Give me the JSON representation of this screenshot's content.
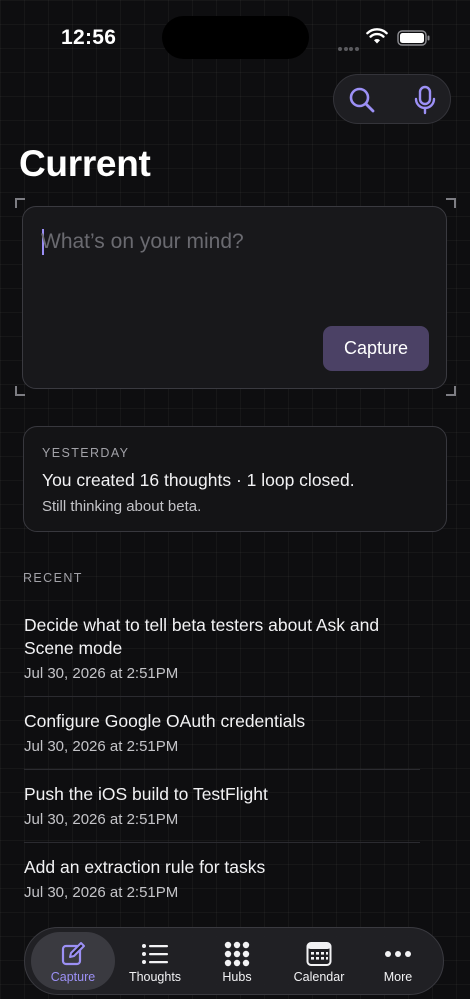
{
  "status_bar": {
    "time": "12:56"
  },
  "toolbar": {
    "icons": [
      "search-icon",
      "microphone-icon"
    ]
  },
  "page": {
    "title": "Current"
  },
  "capture": {
    "placeholder": "What’s on your mind?",
    "button_label": "Capture"
  },
  "summary": {
    "label": "YESTERDAY",
    "headline": "You created 16 thoughts · 1 loop closed.",
    "note": "Still thinking about beta."
  },
  "recent": {
    "label": "RECENT",
    "items": [
      {
        "title": "Decide what to tell beta testers about Ask and Scene mode",
        "date": "Jul 30, 2026 at 2:51PM"
      },
      {
        "title": "Configure Google OAuth credentials",
        "date": "Jul 30, 2026 at 2:51PM"
      },
      {
        "title": "Push the iOS build to TestFlight",
        "date": "Jul 30, 2026 at 2:51PM"
      },
      {
        "title": "Add an extraction rule for tasks",
        "date": "Jul 30, 2026 at 2:51PM"
      }
    ]
  },
  "tab_bar": {
    "tabs": [
      {
        "label": "Capture",
        "icon": "compose-icon",
        "active": true
      },
      {
        "label": "Thoughts",
        "icon": "list-icon",
        "active": false
      },
      {
        "label": "Hubs",
        "icon": "grid-dots-icon",
        "active": false
      },
      {
        "label": "Calendar",
        "icon": "calendar-icon",
        "active": false
      },
      {
        "label": "More",
        "icon": "more-dots-icon",
        "active": false
      }
    ]
  },
  "colors": {
    "background": "#0e0e10",
    "accent": "#9c90f5",
    "capture_button": "#4b4165",
    "card": "#18181b"
  }
}
